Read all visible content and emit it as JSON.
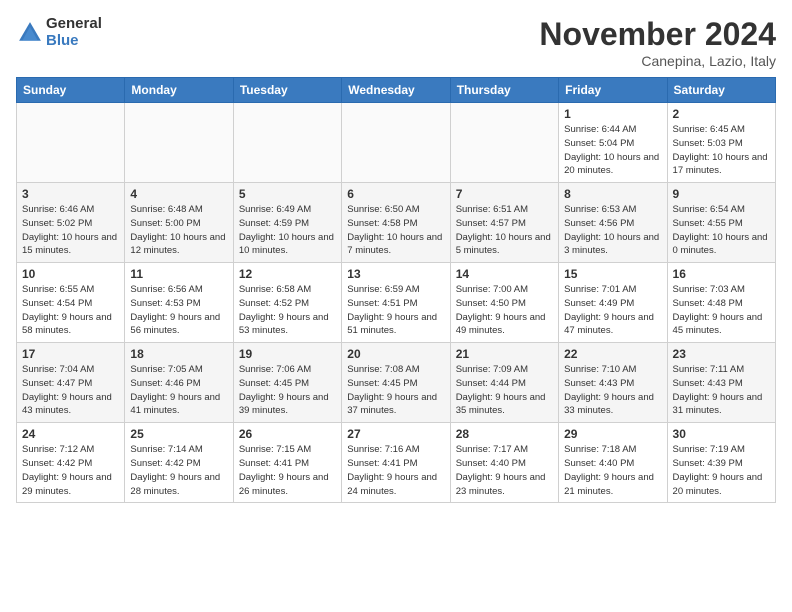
{
  "app": {
    "logo_line1": "General",
    "logo_line2": "Blue"
  },
  "header": {
    "title": "November 2024",
    "subtitle": "Canepina, Lazio, Italy"
  },
  "weekdays": [
    "Sunday",
    "Monday",
    "Tuesday",
    "Wednesday",
    "Thursday",
    "Friday",
    "Saturday"
  ],
  "weeks": [
    [
      {
        "day": "",
        "info": ""
      },
      {
        "day": "",
        "info": ""
      },
      {
        "day": "",
        "info": ""
      },
      {
        "day": "",
        "info": ""
      },
      {
        "day": "",
        "info": ""
      },
      {
        "day": "1",
        "info": "Sunrise: 6:44 AM\nSunset: 5:04 PM\nDaylight: 10 hours and 20 minutes."
      },
      {
        "day": "2",
        "info": "Sunrise: 6:45 AM\nSunset: 5:03 PM\nDaylight: 10 hours and 17 minutes."
      }
    ],
    [
      {
        "day": "3",
        "info": "Sunrise: 6:46 AM\nSunset: 5:02 PM\nDaylight: 10 hours and 15 minutes."
      },
      {
        "day": "4",
        "info": "Sunrise: 6:48 AM\nSunset: 5:00 PM\nDaylight: 10 hours and 12 minutes."
      },
      {
        "day": "5",
        "info": "Sunrise: 6:49 AM\nSunset: 4:59 PM\nDaylight: 10 hours and 10 minutes."
      },
      {
        "day": "6",
        "info": "Sunrise: 6:50 AM\nSunset: 4:58 PM\nDaylight: 10 hours and 7 minutes."
      },
      {
        "day": "7",
        "info": "Sunrise: 6:51 AM\nSunset: 4:57 PM\nDaylight: 10 hours and 5 minutes."
      },
      {
        "day": "8",
        "info": "Sunrise: 6:53 AM\nSunset: 4:56 PM\nDaylight: 10 hours and 3 minutes."
      },
      {
        "day": "9",
        "info": "Sunrise: 6:54 AM\nSunset: 4:55 PM\nDaylight: 10 hours and 0 minutes."
      }
    ],
    [
      {
        "day": "10",
        "info": "Sunrise: 6:55 AM\nSunset: 4:54 PM\nDaylight: 9 hours and 58 minutes."
      },
      {
        "day": "11",
        "info": "Sunrise: 6:56 AM\nSunset: 4:53 PM\nDaylight: 9 hours and 56 minutes."
      },
      {
        "day": "12",
        "info": "Sunrise: 6:58 AM\nSunset: 4:52 PM\nDaylight: 9 hours and 53 minutes."
      },
      {
        "day": "13",
        "info": "Sunrise: 6:59 AM\nSunset: 4:51 PM\nDaylight: 9 hours and 51 minutes."
      },
      {
        "day": "14",
        "info": "Sunrise: 7:00 AM\nSunset: 4:50 PM\nDaylight: 9 hours and 49 minutes."
      },
      {
        "day": "15",
        "info": "Sunrise: 7:01 AM\nSunset: 4:49 PM\nDaylight: 9 hours and 47 minutes."
      },
      {
        "day": "16",
        "info": "Sunrise: 7:03 AM\nSunset: 4:48 PM\nDaylight: 9 hours and 45 minutes."
      }
    ],
    [
      {
        "day": "17",
        "info": "Sunrise: 7:04 AM\nSunset: 4:47 PM\nDaylight: 9 hours and 43 minutes."
      },
      {
        "day": "18",
        "info": "Sunrise: 7:05 AM\nSunset: 4:46 PM\nDaylight: 9 hours and 41 minutes."
      },
      {
        "day": "19",
        "info": "Sunrise: 7:06 AM\nSunset: 4:45 PM\nDaylight: 9 hours and 39 minutes."
      },
      {
        "day": "20",
        "info": "Sunrise: 7:08 AM\nSunset: 4:45 PM\nDaylight: 9 hours and 37 minutes."
      },
      {
        "day": "21",
        "info": "Sunrise: 7:09 AM\nSunset: 4:44 PM\nDaylight: 9 hours and 35 minutes."
      },
      {
        "day": "22",
        "info": "Sunrise: 7:10 AM\nSunset: 4:43 PM\nDaylight: 9 hours and 33 minutes."
      },
      {
        "day": "23",
        "info": "Sunrise: 7:11 AM\nSunset: 4:43 PM\nDaylight: 9 hours and 31 minutes."
      }
    ],
    [
      {
        "day": "24",
        "info": "Sunrise: 7:12 AM\nSunset: 4:42 PM\nDaylight: 9 hours and 29 minutes."
      },
      {
        "day": "25",
        "info": "Sunrise: 7:14 AM\nSunset: 4:42 PM\nDaylight: 9 hours and 28 minutes."
      },
      {
        "day": "26",
        "info": "Sunrise: 7:15 AM\nSunset: 4:41 PM\nDaylight: 9 hours and 26 minutes."
      },
      {
        "day": "27",
        "info": "Sunrise: 7:16 AM\nSunset: 4:41 PM\nDaylight: 9 hours and 24 minutes."
      },
      {
        "day": "28",
        "info": "Sunrise: 7:17 AM\nSunset: 4:40 PM\nDaylight: 9 hours and 23 minutes."
      },
      {
        "day": "29",
        "info": "Sunrise: 7:18 AM\nSunset: 4:40 PM\nDaylight: 9 hours and 21 minutes."
      },
      {
        "day": "30",
        "info": "Sunrise: 7:19 AM\nSunset: 4:39 PM\nDaylight: 9 hours and 20 minutes."
      }
    ]
  ]
}
